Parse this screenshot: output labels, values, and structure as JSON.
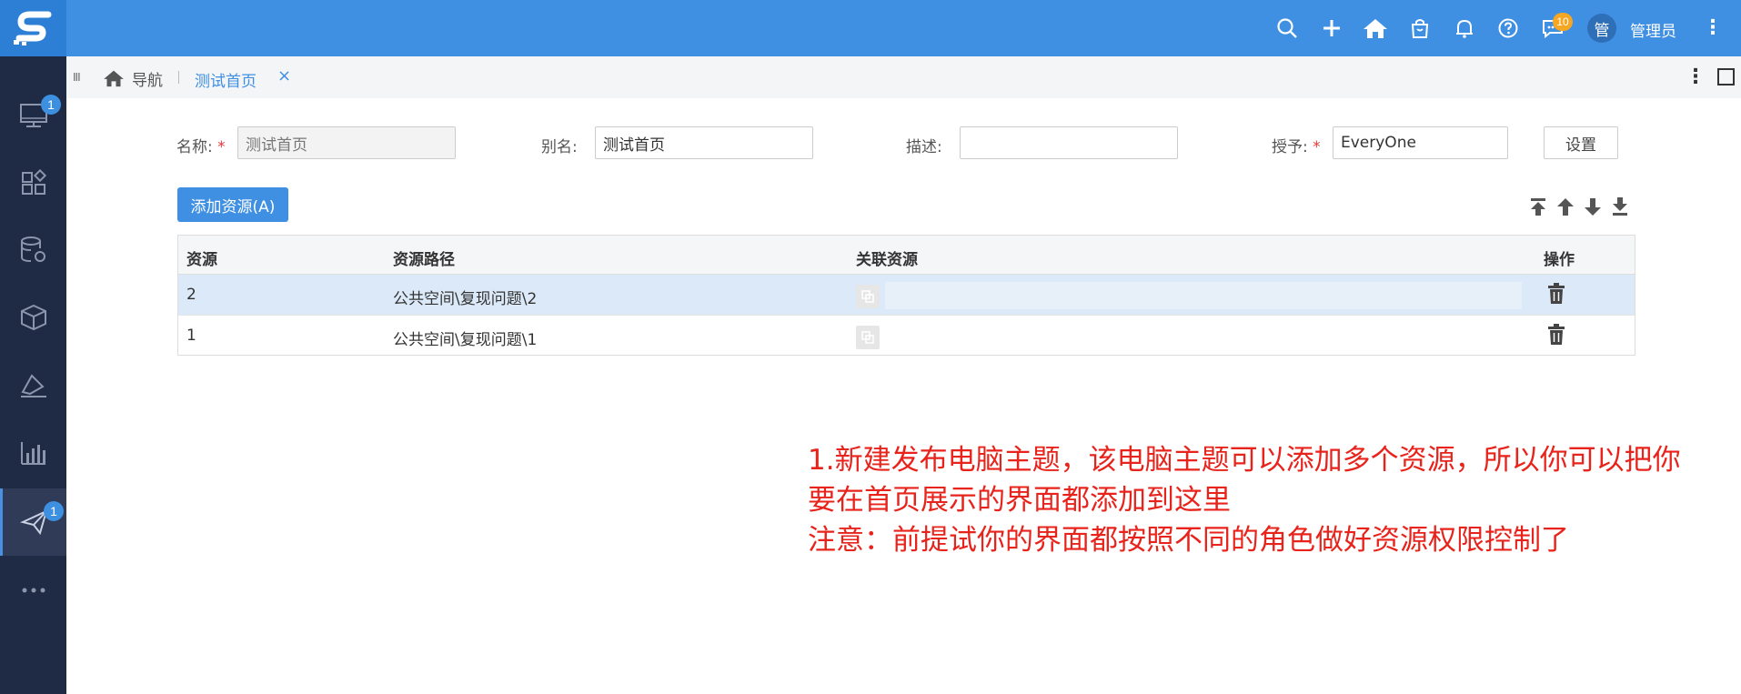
{
  "sidebar": {
    "logo": "S",
    "items": [
      {
        "icon": "monitor-icon",
        "badge": "1"
      },
      {
        "icon": "widgets-icon"
      },
      {
        "icon": "database-gear-icon"
      },
      {
        "icon": "cube-icon"
      },
      {
        "icon": "pen-icon"
      },
      {
        "icon": "bar-chart-icon"
      },
      {
        "icon": "send-icon",
        "badge": "1",
        "active": true
      },
      {
        "icon": "more-icon"
      }
    ]
  },
  "topbar": {
    "icons": [
      "search-icon",
      "plus-icon",
      "home-icon",
      "bag-icon",
      "bell-icon",
      "help-icon",
      "chat-icon"
    ],
    "message_badge": "10",
    "avatar_text": "管",
    "username": "管理员"
  },
  "tabs": {
    "home_label": "导航",
    "active_label": "测试首页",
    "close": "×"
  },
  "form": {
    "name_label": "名称:",
    "name_value": "测试首页",
    "alias_label": "别名:",
    "alias_value": "测试首页",
    "desc_label": "描述:",
    "desc_value": "",
    "grant_label": "授予:",
    "grant_value": "EveryOne",
    "setting_button": "设置",
    "required_mark": "*"
  },
  "toolbar": {
    "add_button": "添加资源(A)"
  },
  "table": {
    "headers": [
      "资源",
      "资源路径",
      "关联资源",
      "操作"
    ],
    "rows": [
      {
        "resource": "2",
        "path": "公共空间\\复现问题\\2",
        "selected": true
      },
      {
        "resource": "1",
        "path": "公共空间\\复现问题\\1",
        "selected": false
      }
    ]
  },
  "annotation": {
    "lines": [
      "1.新建发布电脑主题，该电脑主题可以添加多个资源，所以你可以把你",
      "要在首页展示的界面都添加到这里",
      "注意：前提试你的界面都按照不同的角色做好资源权限控制了"
    ],
    "color": "#e8231b"
  },
  "colors": {
    "primary": "#3f8fe2",
    "sidebar_bg": "#1f2a44"
  }
}
